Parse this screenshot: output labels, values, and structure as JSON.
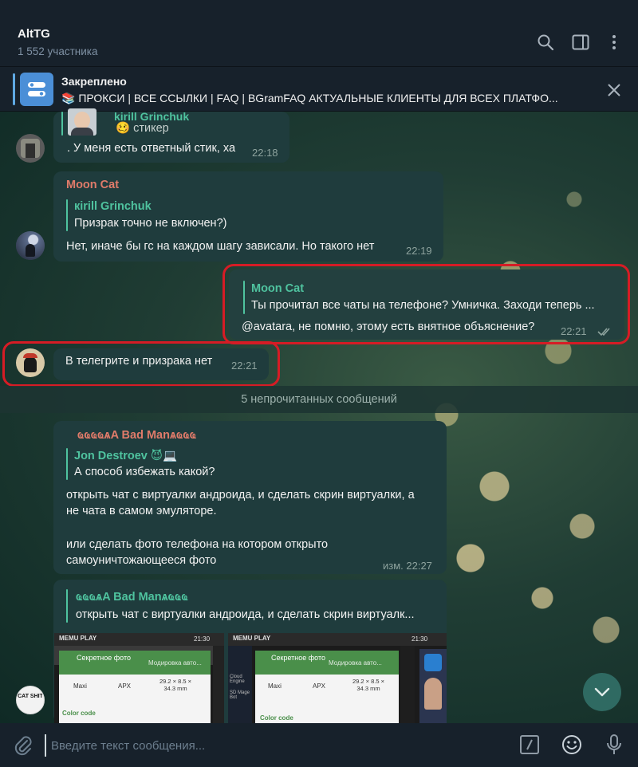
{
  "header": {
    "title": "AltTG",
    "subtitle": "1 552 участника"
  },
  "pinned": {
    "title": "Закреплено",
    "text": "📚 ПРОКСИ | ВСЕ ССЫЛКИ | FAQ | BGramFAQ   АКТУАЛЬНЫЕ КЛИЕНТЫ ДЛЯ ВСЕХ ПЛАТФО..."
  },
  "messages": {
    "m1": {
      "reply_author": "kirill Grinchuk",
      "reply_text": "🥴 стикер",
      "text": ". У меня есть ответный стик, ха",
      "time": "22:18"
    },
    "m2": {
      "sender": "Moon Cat",
      "reply_author": "кirill Grinchuk",
      "reply_text": "Призрак точно не включен?)",
      "text": "Нет, иначе бы гс на каждом шагу зависали. Но такого нет",
      "time": "22:19"
    },
    "m3": {
      "reply_author": "Moon Cat",
      "reply_text": "Ты прочитал все чаты на телефоне? Умничка. Заходи теперь ...",
      "text": "@avatara, не помню, этому есть внятное объяснение?",
      "time": "22:21"
    },
    "m4": {
      "text": "В телегрите и призрака нет",
      "time": "22:21"
    },
    "unread": "5 непрочитанных сообщений",
    "m5": {
      "sender": "ҩҩҩҩѧA Bad Manѧҩҩҩ",
      "reply_author": "Jon Destroev 😈💻",
      "reply_text": "А способ избежать какой?",
      "line1": "открыть чат с виртуалки андроида, и сделать скрин виртуалки, а",
      "line2": "не чата в самом эмуляторе.",
      "line3": "или сделать фото телефона на котором открыто",
      "line4": "самоуничтожающееся фото",
      "time": "изм. 22:27"
    },
    "m6": {
      "reply_author": "ҩҩҩѧA Bad Manѧҩҩҩ",
      "reply_text": "открыть чат с виртуалки андроида, и сделать скрин виртуалк...",
      "shot1": {
        "brand": "MEMU PLAY",
        "clock": "21:30",
        "title": "Секретное фото",
        "subtitle": "Модировка авто...",
        "col1": "Maxi",
        "col2": "APX",
        "col3": "29.2 × 8.5 × 34.3 mm",
        "footer": "Color code"
      },
      "shot2": {
        "brand": "MEMU PLAY",
        "clock": "21:30",
        "title": "Секретное фото",
        "subtitle": "Модировка авто...",
        "col1": "Maxi",
        "col2": "APX",
        "col3": "29.2 × 8.5 × 34.3 mm",
        "footer": "Color code",
        "side1": "Cloud Engine",
        "side2": "SD Mage Bot"
      }
    }
  },
  "avatar5_text": "CAT SHIT",
  "input": {
    "placeholder": "Введите текст сообщения..."
  },
  "colors": {
    "accent_blue": "#5fa9e3",
    "sender_moon_cat": "#e07b6a",
    "reply_green": "#4fc39f",
    "highlight_red": "#d61c25"
  }
}
